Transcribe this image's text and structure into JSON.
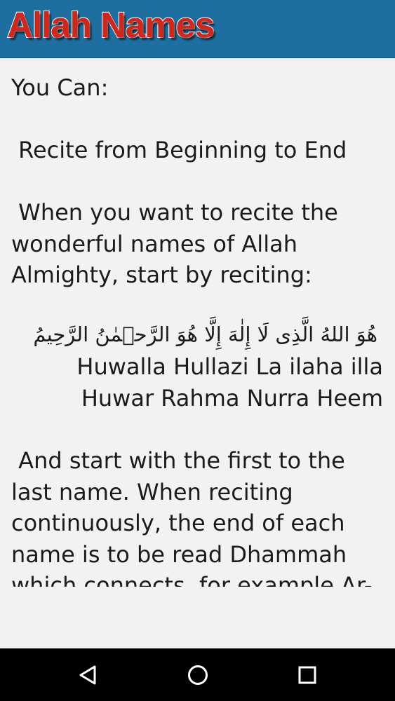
{
  "app_bar": {
    "title": "Allah Names",
    "colors": {
      "background": "#1d6fa0",
      "title_fill": "#d32519",
      "title_outline": "#ffffff"
    }
  },
  "content": {
    "intro_text": "You Can:\n\n Recite from Beginning to End\n\n When you want to recite the wonderful names of Allah Almighty, start by reciting:",
    "arabic_text": "هُوَ اللهُ الَّذِى لَا إِلٰهَ إِلَّا هُوَ الرَّحۡمٰنُ الرَّحِيمُ",
    "transliteration_lines": [
      "Huwalla Hullazi La ilaha illa",
      "Huwar Rahma Nurra Heem"
    ],
    "body_text": " And start with the first to the last name. When reciting continuously, the end of each name is to be read Dhammah which connects, for example Ar-"
  },
  "nav_bar": {
    "buttons": [
      {
        "name": "back",
        "icon": "back-triangle-icon"
      },
      {
        "name": "home",
        "icon": "home-circle-icon"
      },
      {
        "name": "recents",
        "icon": "recents-square-icon"
      }
    ],
    "colors": {
      "background": "#000000",
      "icon": "#ffffff"
    }
  }
}
